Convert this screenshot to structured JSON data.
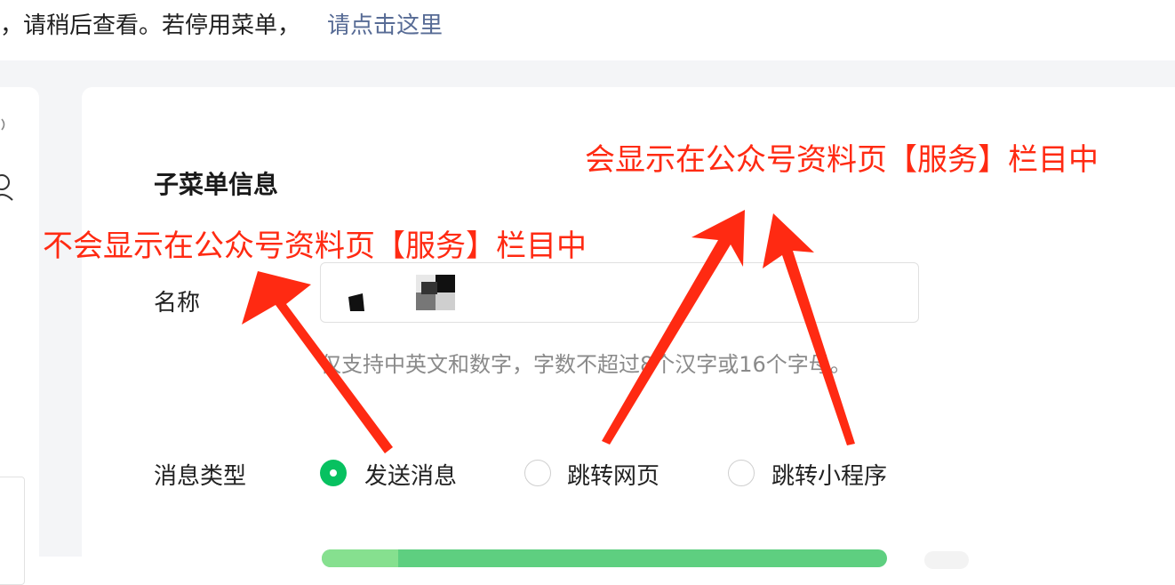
{
  "notice": {
    "text": "，请稍后查看。若停用菜单，",
    "link": "请点击这里"
  },
  "submenu": {
    "title": "子菜单信息",
    "name_label": "名称",
    "name_value": "",
    "hint": "仅支持中英文和数字，字数不超过8个汉字或16个字母。",
    "message_type_label": "消息类型",
    "message_type_options": [
      {
        "label": "发送消息",
        "selected": true
      },
      {
        "label": "跳转网页",
        "selected": false
      },
      {
        "label": "跳转小程序",
        "selected": false
      }
    ]
  },
  "annotations": {
    "right": "会显示在公众号资料页【服务】栏目中",
    "left": "不会显示在公众号资料页【服务】栏目中"
  },
  "colors": {
    "accent_green": "#07c160",
    "link_blue": "#576b95",
    "annotation_red": "#ff2a12"
  }
}
